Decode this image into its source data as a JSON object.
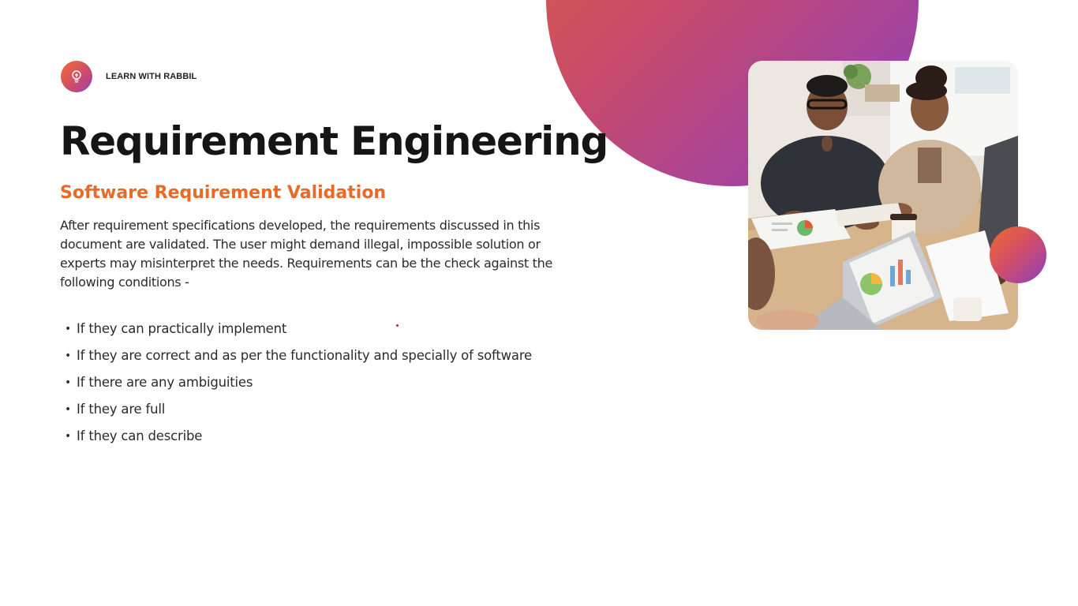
{
  "brand": {
    "name": "LEARN WITH RABBIL",
    "logo_icon": "lightbulb-icon"
  },
  "title": "Requirement Engineering",
  "subtitle": "Software Requirement Validation",
  "paragraph": "After requirement specifications developed, the requirements discussed in this document are validated. The user might demand illegal, impossible solution or experts may misinterpret the needs. Requirements can be the check against the following conditions -",
  "bullets": [
    "If they can practically implement",
    "If they are correct and as per the functionality and specially of software",
    "If there are any ambiguities",
    "If they are full",
    "If they can describe"
  ],
  "colors": {
    "accent_orange": "#e86a26",
    "gradient_start": "#e0603a",
    "gradient_end": "#8e3fbf",
    "title_color": "#151515"
  }
}
